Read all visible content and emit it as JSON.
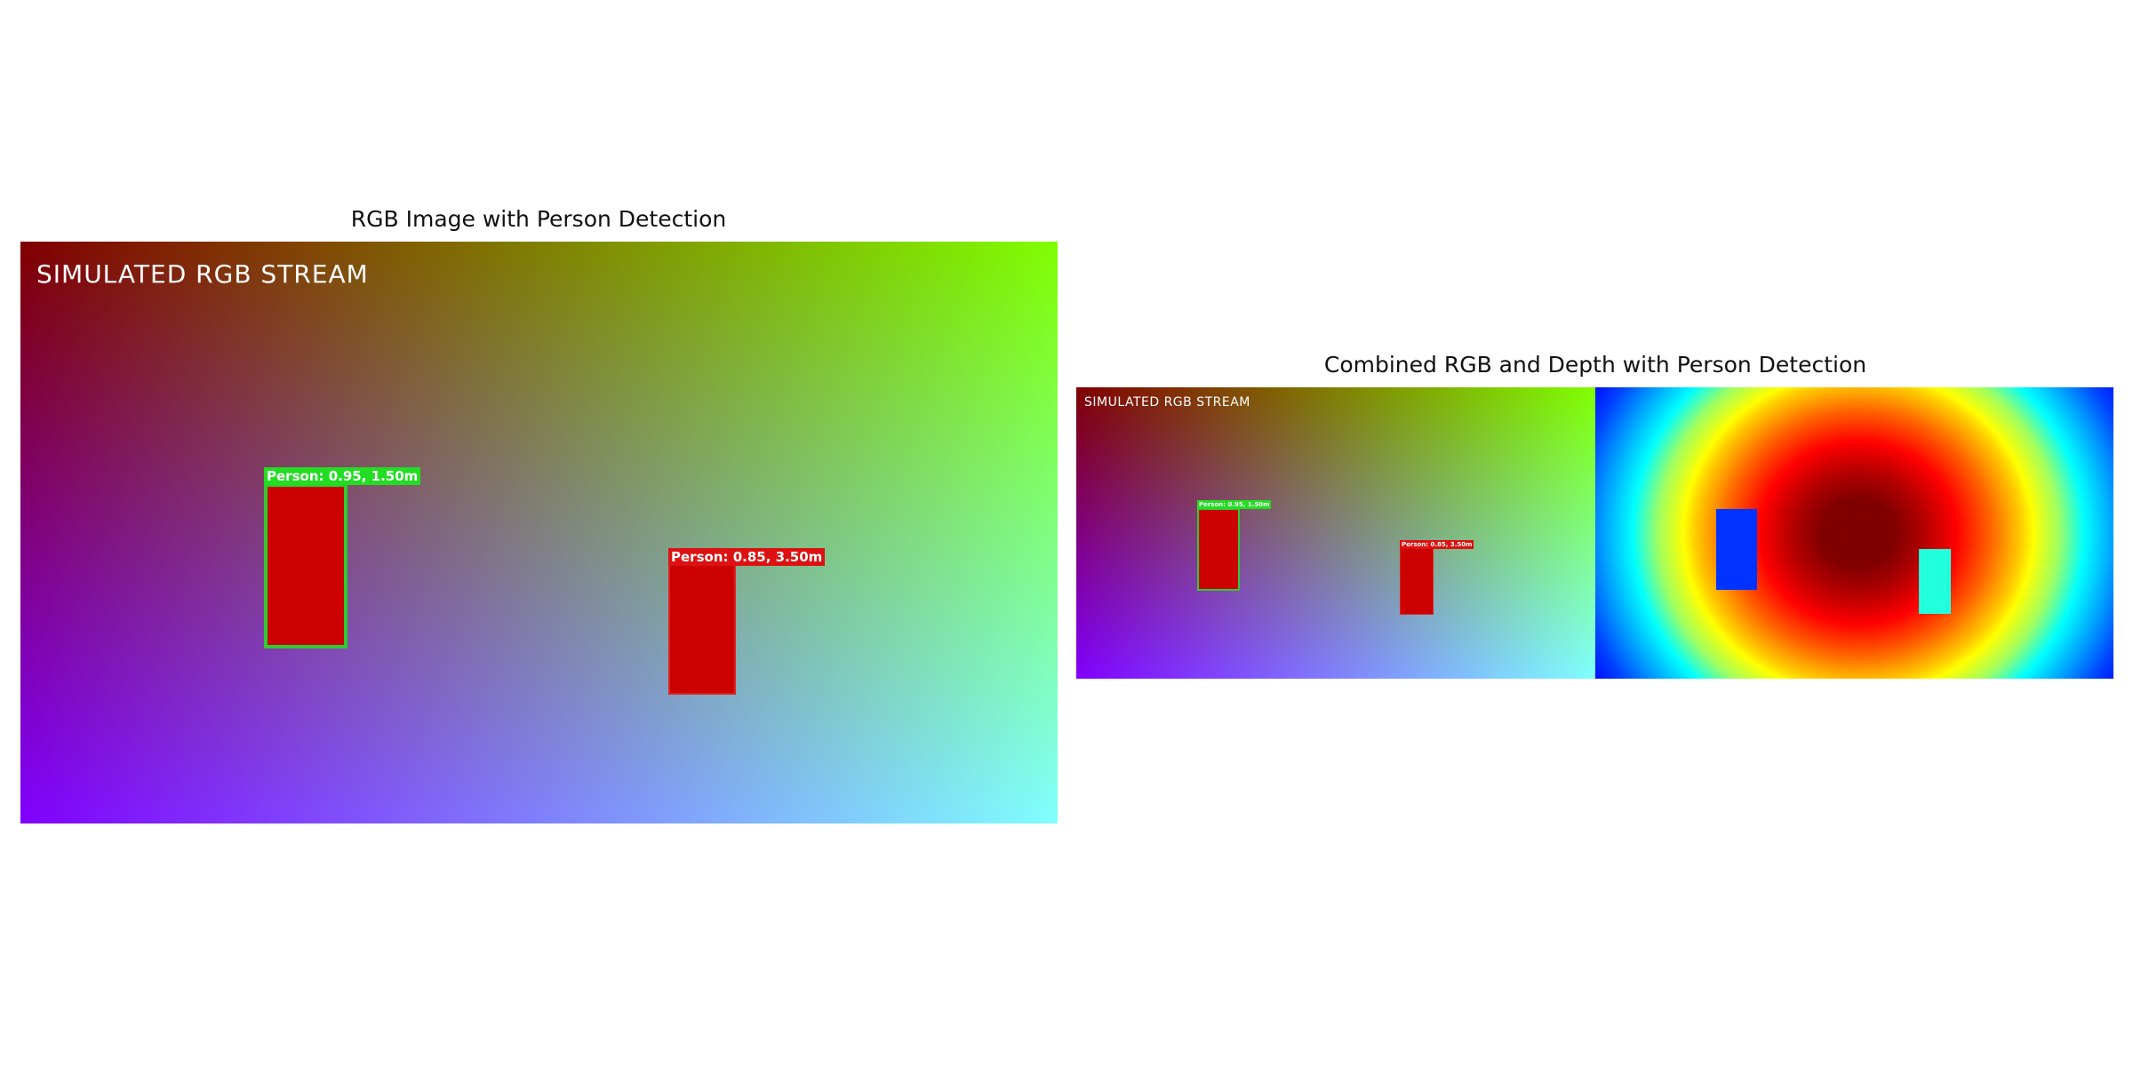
{
  "panels": {
    "left_title": "RGB Image with Person Detection",
    "right_title": "Combined RGB and Depth with Person Detection"
  },
  "stream": {
    "label": "SIMULATED RGB STREAM"
  },
  "detections": [
    {
      "label": "Person: 0.95, 1.50m",
      "confidence": 0.95,
      "distance_m": 1.5,
      "color": "#22dd22",
      "box_color": "#cc0000"
    },
    {
      "label": "Person: 0.85, 3.50m",
      "confidence": 0.85,
      "distance_m": 3.5,
      "color": "#dd1111",
      "box_color": "#cc0000"
    }
  ],
  "colors": {
    "rgb_top_left": "#800000",
    "rgb_top_right": "#80ff00",
    "rgb_bottom_left": "#8000ff",
    "rgb_bottom_right": "#80ffff",
    "depth_near_block": "#0033ff",
    "depth_far_block": "#22ffdd"
  }
}
